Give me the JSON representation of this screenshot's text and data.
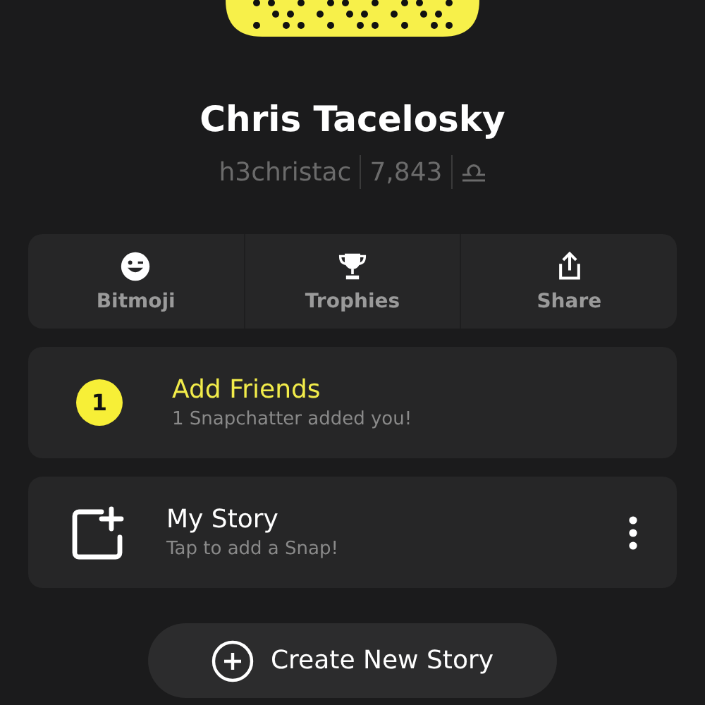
{
  "profile": {
    "name": "Chris Tacelosky",
    "username": "h3christac",
    "score": "7,843"
  },
  "actions": [
    {
      "kind": "bitmoji",
      "label": "Bitmoji"
    },
    {
      "kind": "trophies",
      "label": "Trophies"
    },
    {
      "kind": "share",
      "label": "Share"
    }
  ],
  "add_friends": {
    "count": "1",
    "title": "Add Friends",
    "subtitle": "1 Snapchatter added you!"
  },
  "my_story": {
    "title": "My Story",
    "subtitle": "Tap to add a Snap!"
  },
  "create_button": {
    "label": "Create New Story"
  }
}
